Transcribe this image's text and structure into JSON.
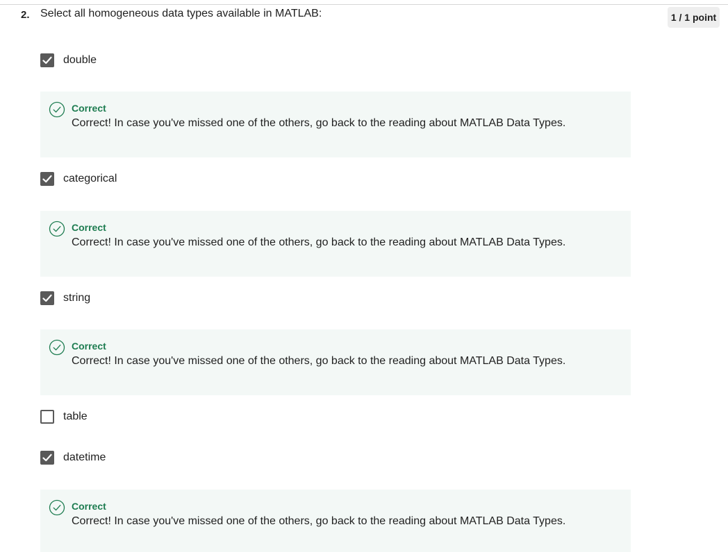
{
  "question": {
    "number": "2.",
    "text": "Select all homogeneous data types available in MATLAB:",
    "score": "1 / 1 point"
  },
  "options": [
    {
      "label": "double",
      "checked": true
    },
    {
      "label": "categorical",
      "checked": true
    },
    {
      "label": "string",
      "checked": true
    },
    {
      "label": "table",
      "checked": false
    },
    {
      "label": "datetime",
      "checked": true
    }
  ],
  "feedback": [
    {
      "title": "Correct",
      "text": "Correct! In case you've missed one of the others, go back to the reading about MATLAB Data Types."
    },
    {
      "title": "Correct",
      "text": "Correct! In case you've missed one of the others, go back to the reading about MATLAB Data Types."
    },
    {
      "title": "Correct",
      "text": "Correct! In case you've missed one of the others, go back to the reading about MATLAB Data Types."
    },
    {
      "title": "Correct",
      "text": "Correct! In case you've missed one of the others, go back to the reading about MATLAB Data Types."
    }
  ],
  "icons": {
    "checkmark": "checkmark-icon",
    "correct": "check-circle-icon"
  },
  "colors": {
    "checkbox": "#595959",
    "correct_green": "#1d7c50",
    "feedback_bg": "#f3f8f6",
    "score_badge_bg": "#eeeeee"
  }
}
